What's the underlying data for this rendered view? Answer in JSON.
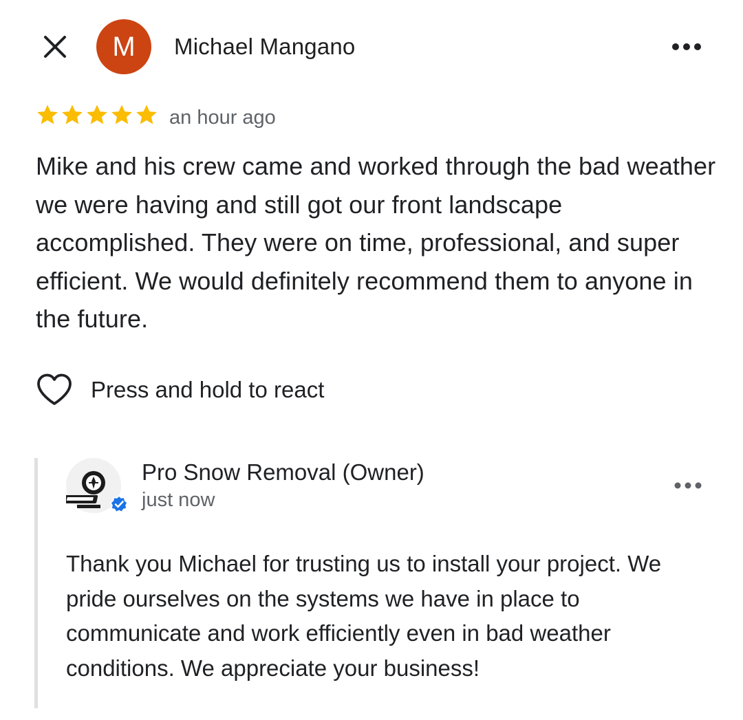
{
  "review": {
    "reviewer": {
      "initial": "M",
      "name": "Michael Mangano",
      "avatar_color": "#cc4412"
    },
    "rating": 5,
    "max_rating": 5,
    "star_color": "#fbbc04",
    "time_ago": "an hour ago",
    "text": "Mike and his crew came and worked through the bad weather we were having and still got our front landscape accomplished. They were on time, professional, and super efficient. We would definitely recommend them to anyone in the future.",
    "react_label": "Press and hold to react",
    "icons": {
      "close": "close-icon",
      "more": "more-horizontal-icon",
      "react": "heart-outline-icon",
      "star": "star-icon"
    }
  },
  "owner_reply": {
    "name": "Pro Snow Removal (Owner)",
    "time_ago": "just now",
    "text": "Thank you Michael for trusting us to install your project. We pride ourselves on the systems we have in place to communicate and work efficiently even in bad weather conditions. We appreciate your business!",
    "verified_color": "#1a73e8",
    "icons": {
      "logo": "business-logo-icon",
      "verified": "verified-check-icon",
      "more": "more-horizontal-icon"
    }
  }
}
